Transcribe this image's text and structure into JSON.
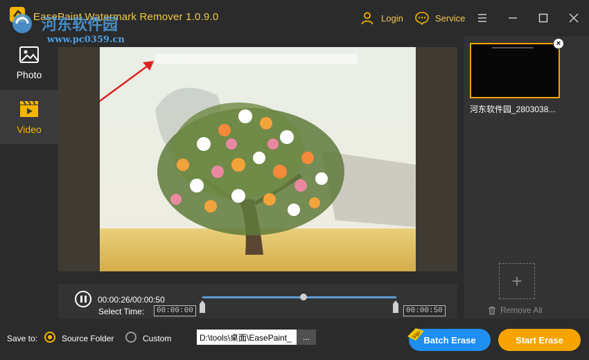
{
  "app": {
    "title": "EasePaint Watermark Remover  1.0.9.0",
    "watermark_text": "河东软件园",
    "watermark_url": "www.pc0359.cn"
  },
  "header": {
    "login_label": "Login",
    "service_label": "Service"
  },
  "sidebar": {
    "items": [
      {
        "label": "Photo",
        "icon": "image-icon",
        "active": false
      },
      {
        "label": "Video",
        "icon": "video-clapper-icon",
        "active": true
      }
    ]
  },
  "player": {
    "current_time": "00:00:26/00:00:50",
    "select_time_label": "Select Time:",
    "start_time": "00:00:00",
    "end_time": "00:00:50",
    "progress": 0.52
  },
  "file_list": {
    "items": [
      {
        "name": "河东软件园_2803038..."
      }
    ],
    "add_icon": "plus-icon",
    "remove_all_label": "Remove All"
  },
  "bottom": {
    "save_to_label": "Save to:",
    "source_folder_label": "Source Folder",
    "custom_label": "Custom",
    "selected": "source_folder",
    "path_value": "D:\\tools\\桌面\\EasePaint_",
    "browse_label": "...",
    "batch_erase_label": "Batch Erase",
    "vip_label": "VIP",
    "start_erase_label": "Start Erase"
  },
  "colors": {
    "accent": "#f7b500",
    "batch_button": "#1f8ef1",
    "start_button": "#f7a400",
    "background": "#2b2b2b"
  }
}
